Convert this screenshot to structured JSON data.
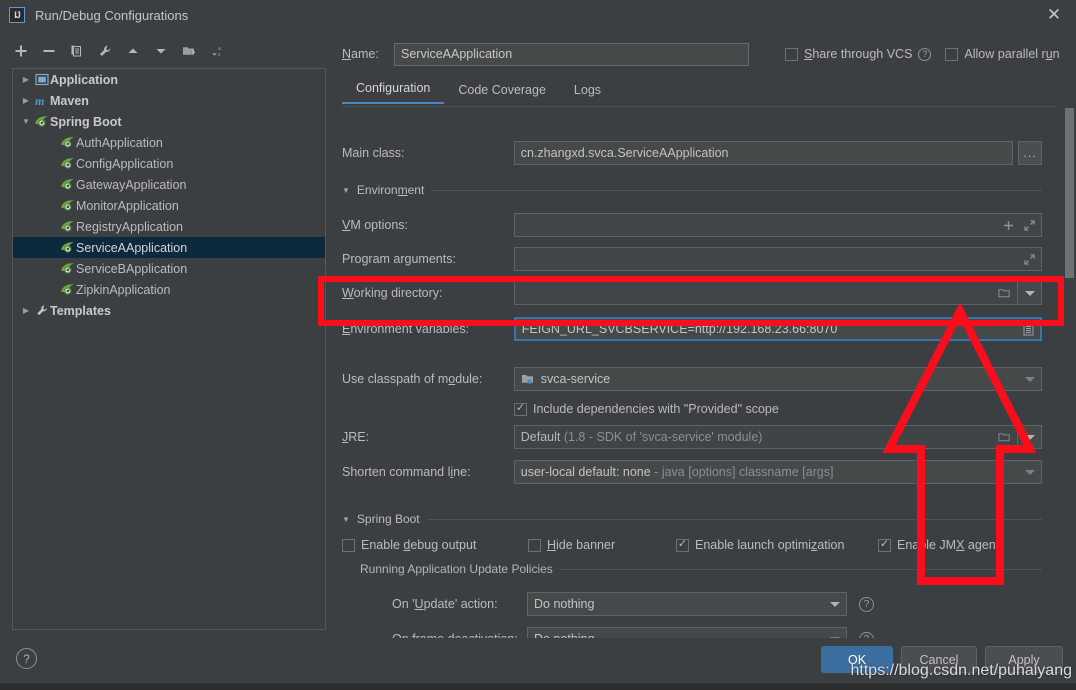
{
  "window": {
    "title": "Run/Debug Configurations",
    "app_icon": "intellij-idea-icon",
    "close_label": "✕"
  },
  "toolbar": {
    "buttons": [
      {
        "name": "add-configuration-button",
        "icon": "plus-icon",
        "label": "+"
      },
      {
        "name": "remove-configuration-button",
        "icon": "minus-icon",
        "label": "−"
      },
      {
        "name": "copy-configuration-button",
        "icon": "copy-icon",
        "label": ""
      },
      {
        "name": "edit-templates-button",
        "icon": "wrench-icon",
        "label": ""
      },
      {
        "name": "move-up-button",
        "icon": "arrow-up-icon",
        "label": ""
      },
      {
        "name": "move-down-button",
        "icon": "arrow-down-icon",
        "label": ""
      },
      {
        "name": "new-folder-button",
        "icon": "folder-add-icon",
        "label": ""
      },
      {
        "name": "sort-configurations-button",
        "icon": "sort-alphabetical-icon",
        "label": ""
      }
    ]
  },
  "tree": {
    "items": [
      {
        "label": "Application",
        "level": 1,
        "expanded": false,
        "icon": "application-icon",
        "group": true,
        "selected": false
      },
      {
        "label": "Maven",
        "level": 1,
        "expanded": false,
        "icon": "maven-icon",
        "group": true,
        "selected": false
      },
      {
        "label": "Spring Boot",
        "level": 1,
        "expanded": true,
        "icon": "spring-boot-icon",
        "group": true,
        "selected": false
      },
      {
        "label": "AuthApplication",
        "level": 2,
        "expanded": null,
        "icon": "spring-boot-icon",
        "group": false,
        "selected": false
      },
      {
        "label": "ConfigApplication",
        "level": 2,
        "expanded": null,
        "icon": "spring-boot-icon",
        "group": false,
        "selected": false
      },
      {
        "label": "GatewayApplication",
        "level": 2,
        "expanded": null,
        "icon": "spring-boot-icon",
        "group": false,
        "selected": false
      },
      {
        "label": "MonitorApplication",
        "level": 2,
        "expanded": null,
        "icon": "spring-boot-icon",
        "group": false,
        "selected": false
      },
      {
        "label": "RegistryApplication",
        "level": 2,
        "expanded": null,
        "icon": "spring-boot-icon",
        "group": false,
        "selected": false
      },
      {
        "label": "ServiceAApplication",
        "level": 2,
        "expanded": null,
        "icon": "spring-boot-icon",
        "group": false,
        "selected": true
      },
      {
        "label": "ServiceBApplication",
        "level": 2,
        "expanded": null,
        "icon": "spring-boot-icon",
        "group": false,
        "selected": false
      },
      {
        "label": "ZipkinApplication",
        "level": 2,
        "expanded": null,
        "icon": "spring-boot-icon",
        "group": false,
        "selected": false
      },
      {
        "label": "Templates",
        "level": 1,
        "expanded": false,
        "icon": "wrench-icon",
        "group": true,
        "selected": false
      }
    ]
  },
  "name_row": {
    "label": "Name:",
    "value": "ServiceAApplication",
    "placeholder": "",
    "share_vcs": {
      "label": "Share through VCS",
      "checked": false,
      "underline_index": 0
    },
    "allow_parallel": {
      "label": "Allow parallel run",
      "checked": false
    }
  },
  "tabs": [
    {
      "label": "Configuration",
      "active": true
    },
    {
      "label": "Code Coverage",
      "active": false
    },
    {
      "label": "Logs",
      "active": false
    }
  ],
  "form": {
    "main_class": {
      "label": "Main class:",
      "value": "cn.zhangxd.svca.ServiceAApplication",
      "browse_label": "..."
    },
    "environment_section": {
      "label": "Environment",
      "expanded": true
    },
    "vm_options": {
      "label": "VM options:",
      "value": "",
      "placeholder": ""
    },
    "program_arguments": {
      "label": "Program arguments:",
      "value": "",
      "placeholder": ""
    },
    "working_directory": {
      "label": "Working directory:",
      "value": "",
      "placeholder": ""
    },
    "environment_variables": {
      "label": "Environment variables:",
      "value": "FEIGN_URL_SVCBSERVICE=http://192.168.23.66:8070"
    },
    "use_classpath": {
      "label": "Use classpath of module:",
      "value": "svca-service"
    },
    "include_provided": {
      "label": "Include dependencies with \"Provided\" scope",
      "checked": true
    },
    "jre": {
      "label": "JRE:",
      "value": "Default",
      "hint": "(1.8 - SDK of 'svca-service' module)"
    },
    "shorten_command_line": {
      "label": "Shorten command line:",
      "value": "user-local default: none",
      "hint": "- java [options] classname [args]"
    }
  },
  "spring_boot_section": {
    "label": "Spring Boot",
    "expanded": true,
    "checkboxes": [
      {
        "label": "Enable debug output",
        "checked": false
      },
      {
        "label": "Hide banner",
        "checked": false
      },
      {
        "label": "Enable launch optimization",
        "checked": true
      },
      {
        "label": "Enable JMX agent",
        "checked": true
      }
    ],
    "update_policies": {
      "label": "Running Application Update Policies",
      "rows": [
        {
          "label": "On 'Update' action:",
          "value": "Do nothing",
          "help": "?"
        },
        {
          "label": "On frame deactivation:",
          "value": "Do nothing",
          "help": "?"
        }
      ]
    }
  },
  "footer": {
    "help_label": "?",
    "ok_label": "OK",
    "cancel_label": "Cancel",
    "apply_label": "Apply"
  },
  "watermark": {
    "text": "https://blog.csdn.net/puhaiyang"
  },
  "annotations": {
    "highlight_color": "#fc0d1c",
    "highlight_box": {
      "name": "environment-variables-highlight-box"
    },
    "arrow": {
      "name": "red-up-arrow-annotation"
    }
  },
  "colors": {
    "background": "#3c3f41",
    "selection": "#0d293e",
    "accent": "#3c6ea0",
    "annotation_red": "#fc0d1c",
    "spring_green": "#6aaa3c"
  }
}
